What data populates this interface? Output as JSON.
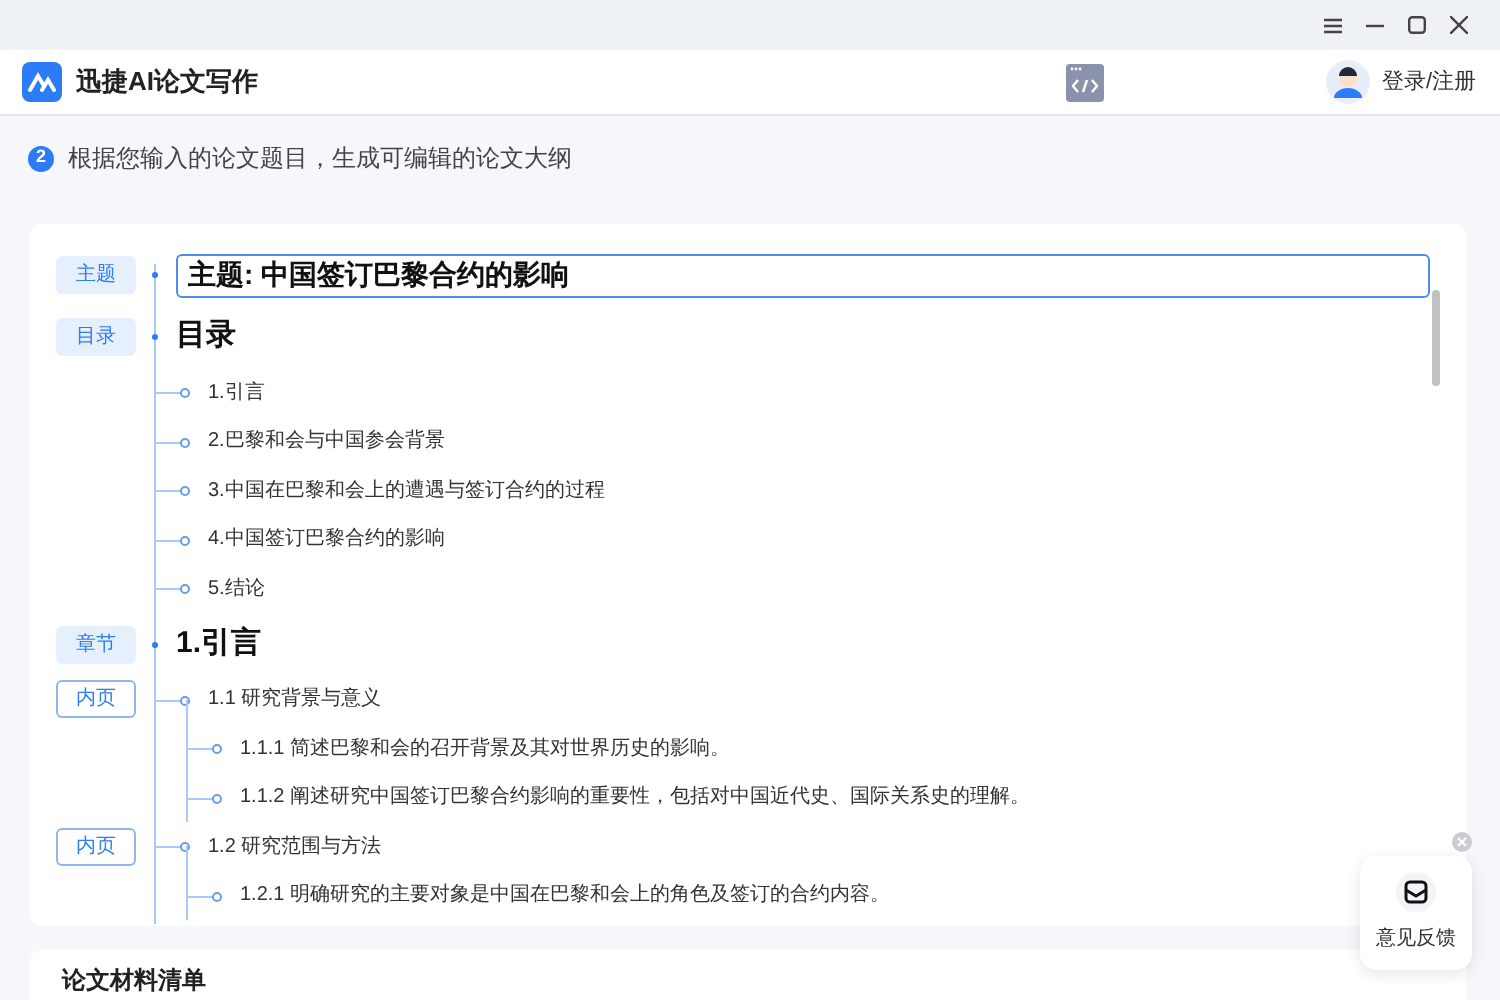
{
  "app": {
    "title": "迅捷AI论文写作",
    "account": "登录/注册"
  },
  "step": {
    "number": "2",
    "text": "根据您输入的论文题目，生成可编辑的论文大纲"
  },
  "outline": [
    {
      "tag": {
        "text": "主题",
        "kind": "filled"
      },
      "kind": "title",
      "text": "主题: 中国签订巴黎合约的影响"
    },
    {
      "tag": {
        "text": "目录",
        "kind": "filled"
      },
      "kind": "heading",
      "text": "目录",
      "children": [
        {
          "text": "1.引言"
        },
        {
          "text": "2.巴黎和会与中国参会背景"
        },
        {
          "text": "3.中国在巴黎和会上的遭遇与签订合约的过程"
        },
        {
          "text": "4.中国签订巴黎合约的影响"
        },
        {
          "text": "5.结论"
        }
      ]
    },
    {
      "tag": {
        "text": "章节",
        "kind": "filled"
      },
      "kind": "heading",
      "text": "1.引言",
      "children": [
        {
          "tag": {
            "text": "内页",
            "kind": "outline"
          },
          "text": "1.1 研究背景与意义",
          "children": [
            {
              "text": "1.1.1 简述巴黎和会的召开背景及其对世界历史的影响。"
            },
            {
              "text": "1.1.2 阐述研究中国签订巴黎合约影响的重要性，包括对中国近代史、国际关系史的理解。"
            }
          ]
        },
        {
          "tag": {
            "text": "内页",
            "kind": "outline"
          },
          "text": "1.2 研究范围与方法",
          "children": [
            {
              "text": "1.2.1 明确研究的主要对象是中国在巴黎和会上的角色及签订的合约内容。"
            }
          ]
        }
      ]
    }
  ],
  "next_section": {
    "title": "论文材料清单"
  },
  "feedback": {
    "label": "意见反馈"
  }
}
